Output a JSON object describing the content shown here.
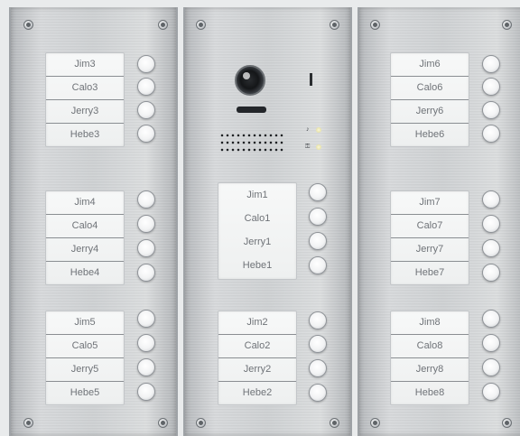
{
  "panels": [
    {
      "groups": [
        [
          "Jim3",
          "Calo3",
          "Jerry3",
          "Hebe3"
        ],
        [
          "Jim4",
          "Calo4",
          "Jerry4",
          "Hebe4"
        ],
        [
          "Jim5",
          "Calo5",
          "Jerry5",
          "Hebe5"
        ]
      ]
    },
    {
      "camera_module": true,
      "indicators": [
        "bell-icon",
        "key-icon"
      ],
      "groups": [
        [
          "Jim1",
          "Calo1",
          "Jerry1",
          "Hebe1"
        ],
        [
          "Jim2",
          "Calo2",
          "Jerry2",
          "Hebe2"
        ]
      ]
    },
    {
      "groups": [
        [
          "Jim6",
          "Calo6",
          "Jerry6",
          "Hebe6"
        ],
        [
          "Jim7",
          "Calo7",
          "Jerry7",
          "Hebe7"
        ],
        [
          "Jim8",
          "Calo8",
          "Jerry8",
          "Hebe8"
        ]
      ]
    }
  ],
  "colors": {
    "steel": "#cfd2d4",
    "label_text": "#6f7378",
    "card": "#f2f3f3"
  }
}
